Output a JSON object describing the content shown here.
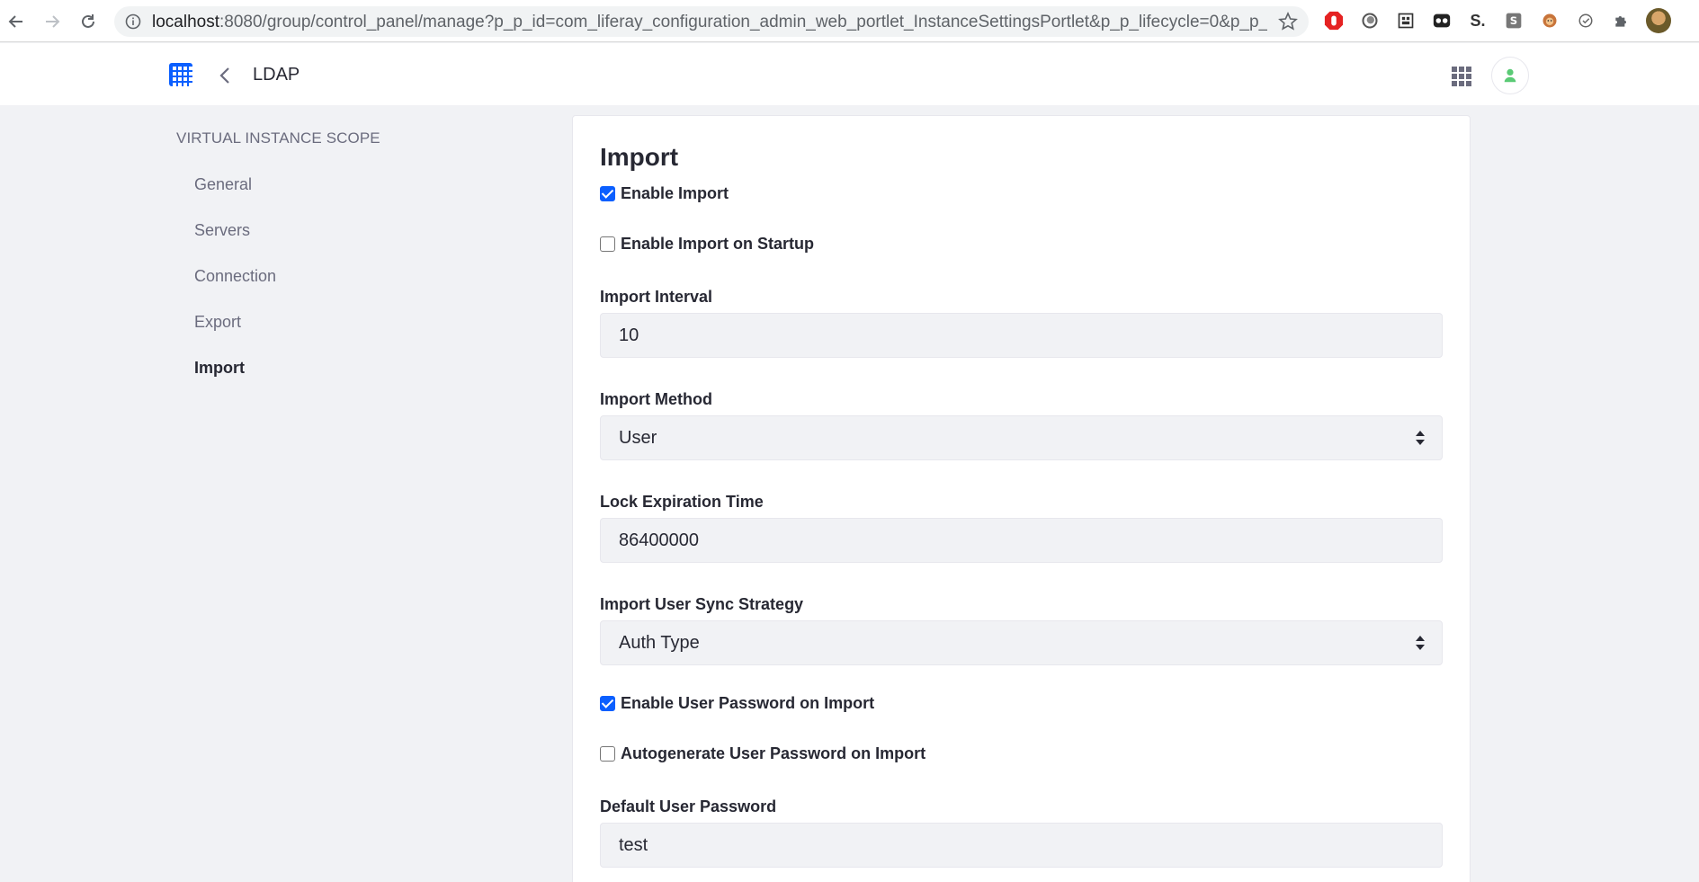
{
  "browser": {
    "url_host": "localhost",
    "url_rest": ":8080/group/control_panel/manage?p_p_id=com_liferay_configuration_admin_web_portlet_InstanceSettingsPortlet&p_p_lifecycle=0&p_p_state=maxi..."
  },
  "header": {
    "title": "LDAP"
  },
  "sidebar": {
    "heading": "VIRTUAL INSTANCE SCOPE",
    "items": [
      {
        "label": "General"
      },
      {
        "label": "Servers"
      },
      {
        "label": "Connection"
      },
      {
        "label": "Export"
      },
      {
        "label": "Import"
      }
    ]
  },
  "form": {
    "title": "Import",
    "enable_import": {
      "label": "Enable Import",
      "checked": true
    },
    "enable_import_startup": {
      "label": "Enable Import on Startup",
      "checked": false
    },
    "import_interval": {
      "label": "Import Interval",
      "value": "10"
    },
    "import_method": {
      "label": "Import Method",
      "value": "User"
    },
    "lock_expiration": {
      "label": "Lock Expiration Time",
      "value": "86400000"
    },
    "sync_strategy": {
      "label": "Import User Sync Strategy",
      "value": "Auth Type"
    },
    "enable_password": {
      "label": "Enable User Password on Import",
      "checked": true
    },
    "autogen_password": {
      "label": "Autogenerate User Password on Import",
      "checked": false
    },
    "default_password": {
      "label": "Default User Password",
      "value": "test"
    }
  },
  "colors": {
    "accent": "#0b5fff",
    "user_icon": "#5aca75"
  }
}
